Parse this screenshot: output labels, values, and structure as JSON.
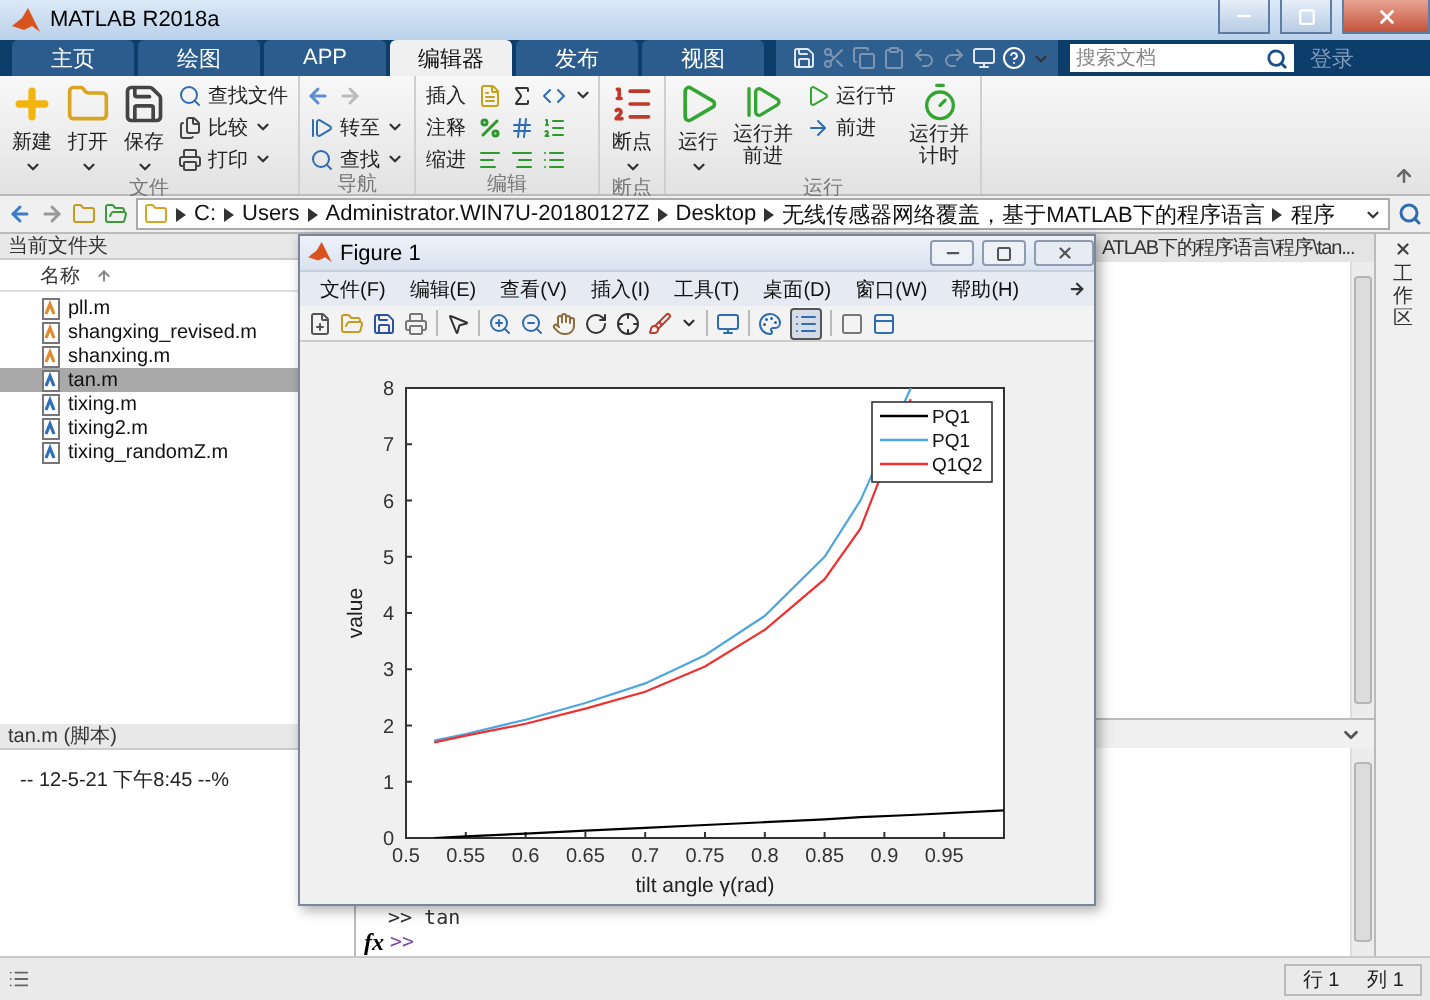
{
  "window": {
    "title": "MATLAB R2018a"
  },
  "tabs": [
    {
      "label": "主页",
      "selected": false
    },
    {
      "label": "绘图",
      "selected": false
    },
    {
      "label": "APP",
      "selected": false
    },
    {
      "label": "编辑器",
      "selected": true
    },
    {
      "label": "发布",
      "selected": false
    },
    {
      "label": "视图",
      "selected": false
    }
  ],
  "search": {
    "placeholder": "搜索文档"
  },
  "sign_in": "登录",
  "ribbon": {
    "file": {
      "label": "文件",
      "new": "新建",
      "open": "打开",
      "save": "保存",
      "find_files": "查找文件",
      "compare": "比较",
      "print": "打印"
    },
    "navigate": {
      "label": "导航",
      "go_to": "转至",
      "find": "查找"
    },
    "edit": {
      "label": "编辑",
      "insert": "插入",
      "comment": "注释",
      "indent": "缩进"
    },
    "breakpoints": {
      "label": "断点",
      "button": "断点"
    },
    "run": {
      "label": "运行",
      "run": "运行",
      "run_and_advance": "运行并前进",
      "run_section": "运行节",
      "advance": "前进",
      "run_and_time": "运行并计时"
    }
  },
  "address": [
    "C:",
    "Users",
    "Administrator.WIN7U-20180127Z",
    "Desktop",
    "无线传感器网络覆盖，基于MATLAB下的程序语言",
    "程序"
  ],
  "current_folder": {
    "title": "当前文件夹",
    "column": "名称",
    "files": [
      {
        "name": "pll.m",
        "kind": "function",
        "selected": false
      },
      {
        "name": "shangxing_revised.m",
        "kind": "function",
        "selected": false
      },
      {
        "name": "shanxing.m",
        "kind": "function",
        "selected": false
      },
      {
        "name": "tan.m",
        "kind": "script",
        "selected": true
      },
      {
        "name": "tixing.m",
        "kind": "script",
        "selected": false
      },
      {
        "name": "tixing2.m",
        "kind": "script",
        "selected": false
      },
      {
        "name": "tixing_randomZ.m",
        "kind": "script",
        "selected": false
      }
    ]
  },
  "details": {
    "title": "tan.m  (脚本)",
    "text": "-- 12-5-21 下午8:45 --%"
  },
  "editor": {
    "tab": "ATLAB下的程序语言\\程序\\tan..."
  },
  "workspace": {
    "title": "工作区"
  },
  "command_window": {
    "lines": [
      ">> tan"
    ],
    "fx": "fx",
    "prompt": ">>"
  },
  "status_bar": {
    "row": "行 1",
    "column": "列 1"
  },
  "figure": {
    "title": "Figure 1",
    "menu": [
      "文件(F)",
      "编辑(E)",
      "查看(V)",
      "插入(I)",
      "工具(T)",
      "桌面(D)",
      "窗口(W)",
      "帮助(H)"
    ],
    "legend_button": {
      "pressed": true
    },
    "chart_data": {
      "type": "line",
      "xlabel": "tilt angle γ(rad)",
      "ylabel": "value",
      "x": [
        0.5236,
        0.55,
        0.6,
        0.65,
        0.7,
        0.75,
        0.8,
        0.85,
        0.88,
        0.922,
        1.0
      ],
      "series": [
        {
          "name": "PQ1",
          "color": "#000000",
          "values": [
            0,
            0.03,
            0.08,
            0.13,
            0.18,
            0.23,
            0.28,
            0.33,
            0.37,
            0.41,
            0.49
          ]
        },
        {
          "name": "PQ1",
          "color": "#4da6e0",
          "values": [
            1.73,
            1.85,
            2.1,
            2.4,
            2.75,
            3.25,
            3.95,
            5.0,
            6.0,
            8.0,
            null
          ]
        },
        {
          "name": "Q1Q2",
          "color": "#f03030",
          "values": [
            1.7,
            1.82,
            2.03,
            2.3,
            2.6,
            3.05,
            3.7,
            4.6,
            5.5,
            7.8,
            null
          ]
        }
      ],
      "legend": true,
      "xlim": [
        0.5,
        1
      ],
      "ylim": [
        0,
        8
      ],
      "xticks": [
        0.5,
        0.55,
        0.6,
        0.65,
        0.7,
        0.75,
        0.8,
        0.85,
        0.9,
        0.95
      ],
      "yticks": [
        0,
        1,
        2,
        3,
        4,
        5,
        6,
        7,
        8
      ]
    }
  }
}
